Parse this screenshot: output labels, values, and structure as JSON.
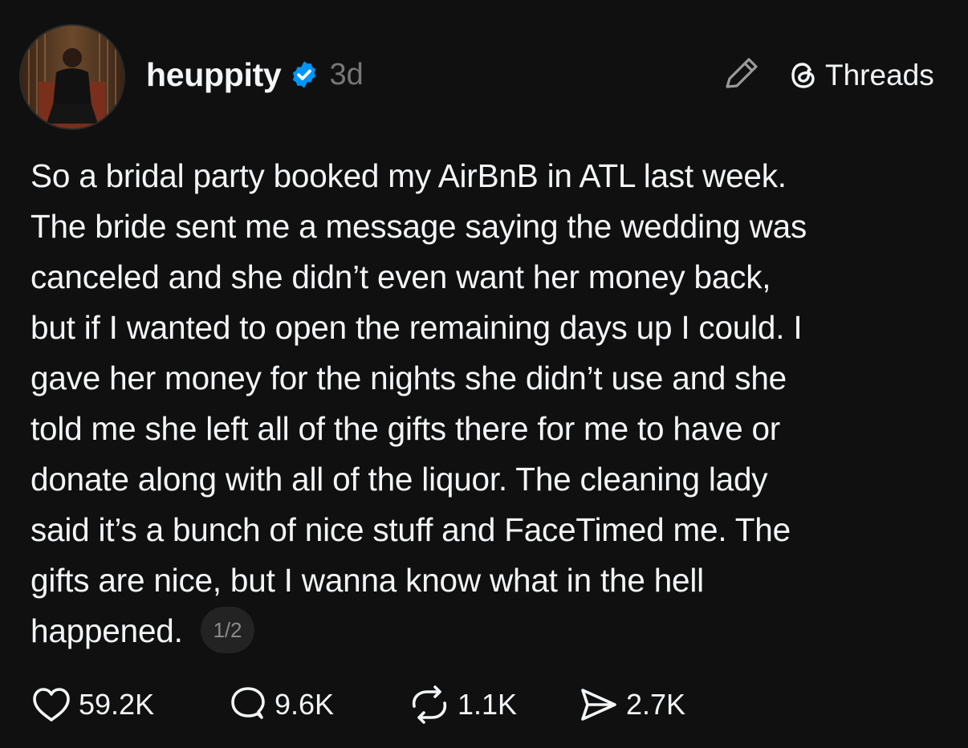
{
  "post": {
    "author": {
      "username": "heuppity",
      "verified": true,
      "time": "3d"
    },
    "brand": {
      "label": "Threads",
      "icon": "threads-logo-icon"
    },
    "compose_icon": "pencil-icon",
    "text": "So a bridal party booked my AirBnB in ATL last week.\nThe bride sent me a message saying the wedding was\ncanceled and she didn’t even want her money back,\nbut if I wanted to open the remaining days up I could. I\ngave her money for the nights she didn’t use and she\ntold me she left all of the gifts there for me to have or\ndonate along with all of the liquor. The cleaning lady\nsaid it’s a bunch of nice stuff and FaceTimed me. The\ngifts are nice, but I wanna know what in the hell\nhappened.",
    "page_indicator": "1/2",
    "stats": {
      "likes": "59.2K",
      "replies": "9.6K",
      "reposts": "1.1K",
      "shares": "2.7K"
    }
  },
  "colors": {
    "background": "#101010",
    "text": "#f3f5f7",
    "muted": "#777777",
    "verified": "#0095f6"
  }
}
